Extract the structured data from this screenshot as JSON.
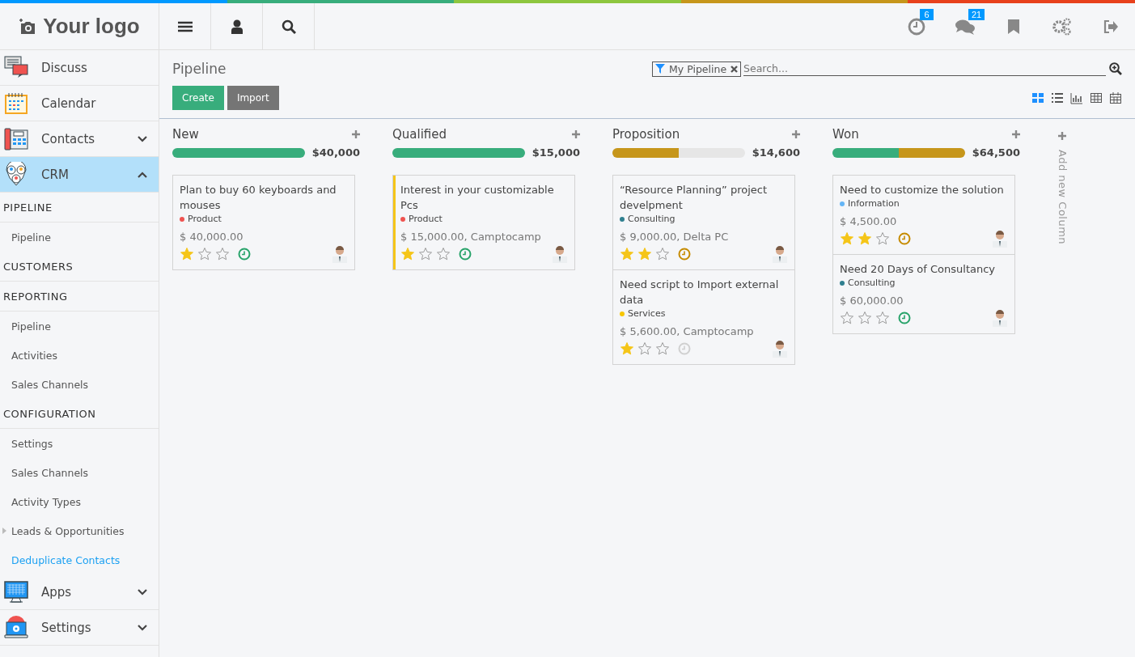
{
  "logo": {
    "text": "Your logo"
  },
  "topbar": {
    "badges": [
      {
        "count": "6"
      },
      {
        "count": "21"
      }
    ]
  },
  "sidebar": {
    "items": [
      {
        "label": "Discuss",
        "selected": false
      },
      {
        "label": "Calendar",
        "selected": false
      },
      {
        "label": "Contacts",
        "selected": false,
        "expanded": false
      },
      {
        "label": "CRM",
        "selected": true,
        "expanded": true,
        "children": [
          {
            "label": "PIPELINE",
            "children": [
              {
                "label": "Pipeline",
                "selected": false
              }
            ]
          },
          {
            "label": "CUSTOMERS"
          },
          {
            "label": "REPORTING",
            "children": [
              {
                "label": "Pipeline",
                "selected": false
              },
              {
                "label": "Activities",
                "selected": false
              },
              {
                "label": "Sales Channels",
                "selected": false
              }
            ]
          },
          {
            "label": "CONFIGURATION",
            "children": [
              {
                "label": "Settings",
                "selected": false
              },
              {
                "label": "Sales Channels",
                "selected": false
              },
              {
                "label": "Activity Types",
                "selected": false
              },
              {
                "label": "Leads & Opportunities",
                "selected": false,
                "expanded": false
              },
              {
                "label": "Deduplicate Contacts",
                "selected": true
              }
            ]
          }
        ]
      },
      {
        "label": "Apps",
        "selected": false,
        "expanded": false
      },
      {
        "label": "Settings",
        "selected": false,
        "expanded": false
      }
    ]
  },
  "page": {
    "title": "Pipeline",
    "buttons": [
      {
        "label": "Create",
        "kind": "primary"
      },
      {
        "label": "Import",
        "kind": "secondary"
      }
    ],
    "search": {
      "facet": "My Pipeline",
      "placeholder": "Search..."
    },
    "views": [
      {
        "selected": true
      },
      {
        "selected": false
      },
      {
        "selected": false
      },
      {
        "selected": false
      },
      {
        "selected": false
      }
    ]
  },
  "columns": [
    {
      "name": "New",
      "total": "$40,000",
      "progress": [
        {
          "color": "#38ad7c",
          "level": 1
        }
      ],
      "cards": [
        {
          "title": "Plan to buy 60 keyboards and mouses",
          "tag": {
            "label": "Product",
            "color": "#ef5350"
          },
          "amount": "$ 40,000.00",
          "stars": 1,
          "activity": {
            "color": "#28a36a"
          },
          "highlighted": false
        }
      ]
    },
    {
      "name": "Qualified",
      "total": "$15,000",
      "progress": [
        {
          "color": "#38ad7c",
          "level": 1
        }
      ],
      "cards": [
        {
          "title": "Interest in your customizable Pcs",
          "tag": {
            "label": "Product",
            "color": "#ef5350"
          },
          "amount": "$ 15,000.00, Camptocamp",
          "stars": 1,
          "activity": {
            "color": "#28a36a"
          },
          "highlighted": true
        }
      ]
    },
    {
      "name": "Proposition",
      "total": "$14,600",
      "progress": [
        {
          "color": "#c6961b",
          "level": 0.5
        }
      ],
      "cards": [
        {
          "title": "“Resource Planning” project develpment",
          "tag": {
            "label": "Consulting",
            "color": "#2f7f8f"
          },
          "amount": "$ 9,000.00, Delta PC",
          "stars": 2,
          "activity": {
            "color": "#c68b00"
          },
          "highlighted": false
        },
        {
          "title": "Need script to Import external data",
          "tag": {
            "label": "Services",
            "color": "#f7c600"
          },
          "amount": "$ 5,600.00, Camptocamp",
          "stars": 1,
          "activity": {
            "color": "#d0d0d0"
          },
          "highlighted": false
        }
      ]
    },
    {
      "name": "Won",
      "total": "$64,500",
      "progress": [
        {
          "color": "#38ad7c",
          "level": 0.5
        },
        {
          "color": "#c6961b",
          "level": 0.5
        }
      ],
      "cards": [
        {
          "title": "Need to customize the solution",
          "tag": {
            "label": "Information",
            "color": "#64b5f6"
          },
          "amount": "$ 4,500.00",
          "stars": 2,
          "activity": {
            "color": "#c68b00"
          },
          "highlighted": false
        },
        {
          "title": "Need 20 Days of Consultancy",
          "tag": {
            "label": "Consulting",
            "color": "#2f7f8f"
          },
          "amount": "$ 60,000.00",
          "stars": 0,
          "activity": {
            "color": "#28a36a"
          },
          "highlighted": false
        }
      ]
    }
  ],
  "add_column": {
    "label": "Add new Column"
  }
}
